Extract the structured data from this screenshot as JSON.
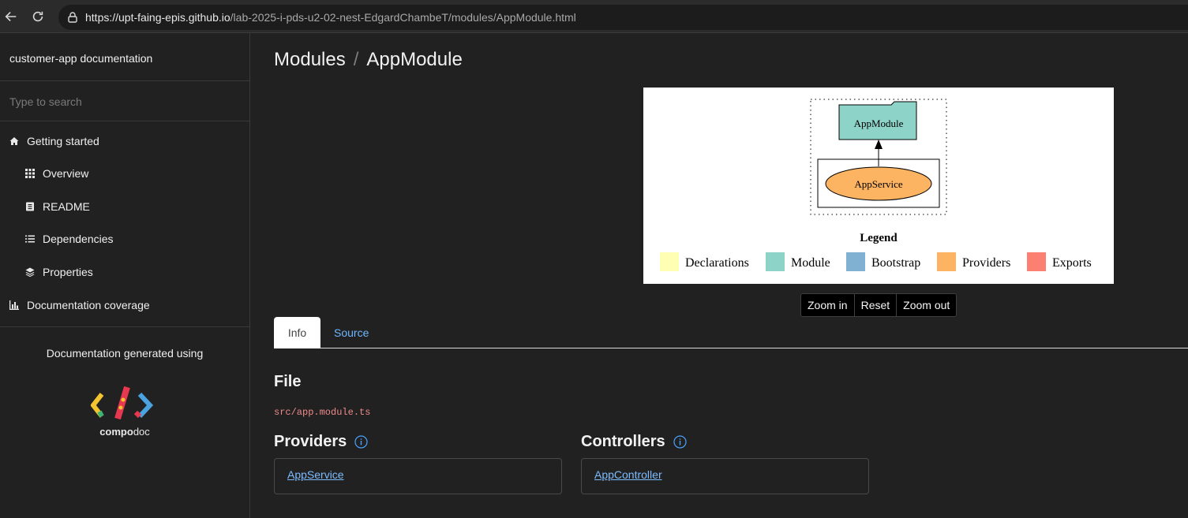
{
  "browser": {
    "url_host": "https://upt-faing-epis.github.io",
    "url_path": "/lab-2025-i-pds-u2-02-nest-EdgardChambeT/modules/AppModule.html"
  },
  "sidebar": {
    "title": "customer-app documentation",
    "search_placeholder": "Type to search",
    "items": [
      {
        "label": "Getting started",
        "icon": "home-icon"
      },
      {
        "label": "Overview",
        "icon": "grid-icon"
      },
      {
        "label": "README",
        "icon": "book-icon"
      },
      {
        "label": "Dependencies",
        "icon": "list-icon"
      },
      {
        "label": "Properties",
        "icon": "layers-icon"
      },
      {
        "label": "Documentation coverage",
        "icon": "bar-chart-icon"
      }
    ],
    "generated_label": "Documentation generated using",
    "compodoc_brand_bold": "compo",
    "compodoc_brand_light": "doc"
  },
  "main": {
    "breadcrumb_parent": "Modules",
    "breadcrumb_sep": "/",
    "breadcrumb_current": "AppModule",
    "graph": {
      "module_label": "AppModule",
      "provider_label": "AppService",
      "legend_title": "Legend",
      "legend": [
        {
          "label": "Declarations",
          "color": "#ffffb3"
        },
        {
          "label": "Module",
          "color": "#8dd3c7"
        },
        {
          "label": "Bootstrap",
          "color": "#80b1d3"
        },
        {
          "label": "Providers",
          "color": "#fdb462"
        },
        {
          "label": "Exports",
          "color": "#fb8072"
        }
      ]
    },
    "zoom": {
      "zoom_in": "Zoom in",
      "reset": "Reset",
      "zoom_out": "Zoom out"
    },
    "tabs": {
      "info": "Info",
      "source": "Source"
    },
    "file_heading": "File",
    "file_path": "src/app.module.ts",
    "providers_heading": "Providers",
    "providers": [
      "AppService"
    ],
    "controllers_heading": "Controllers",
    "controllers": [
      "AppController"
    ]
  },
  "colors": {
    "link": "#7dbcff",
    "file_path": "#ef8a8a",
    "background": "#212121"
  }
}
